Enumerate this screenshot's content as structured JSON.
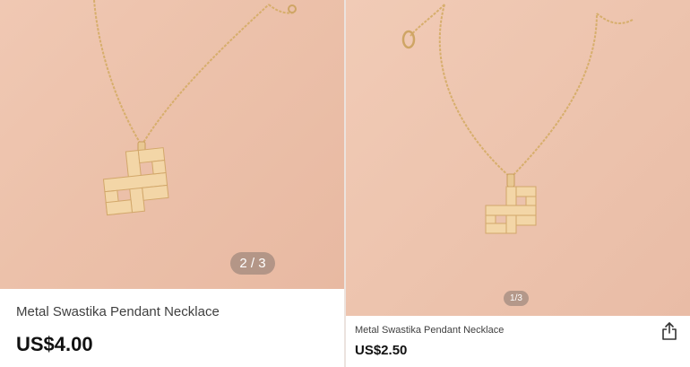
{
  "left_listing": {
    "image_counter": "2 / 3",
    "product_name": "Metal Swastika Pendant Necklace",
    "price": "US$4.00"
  },
  "right_listing": {
    "image_counter": "1/3",
    "product_name": "Metal Swastika Pendant Necklace",
    "price": "US$2.50",
    "share_icon": "share-icon"
  },
  "colors": {
    "photo_background": "#ecc1aa",
    "jewelry_gold": "#d9b071",
    "pendant_gold": "#f2d4a4",
    "counter_pill": "#877670"
  }
}
